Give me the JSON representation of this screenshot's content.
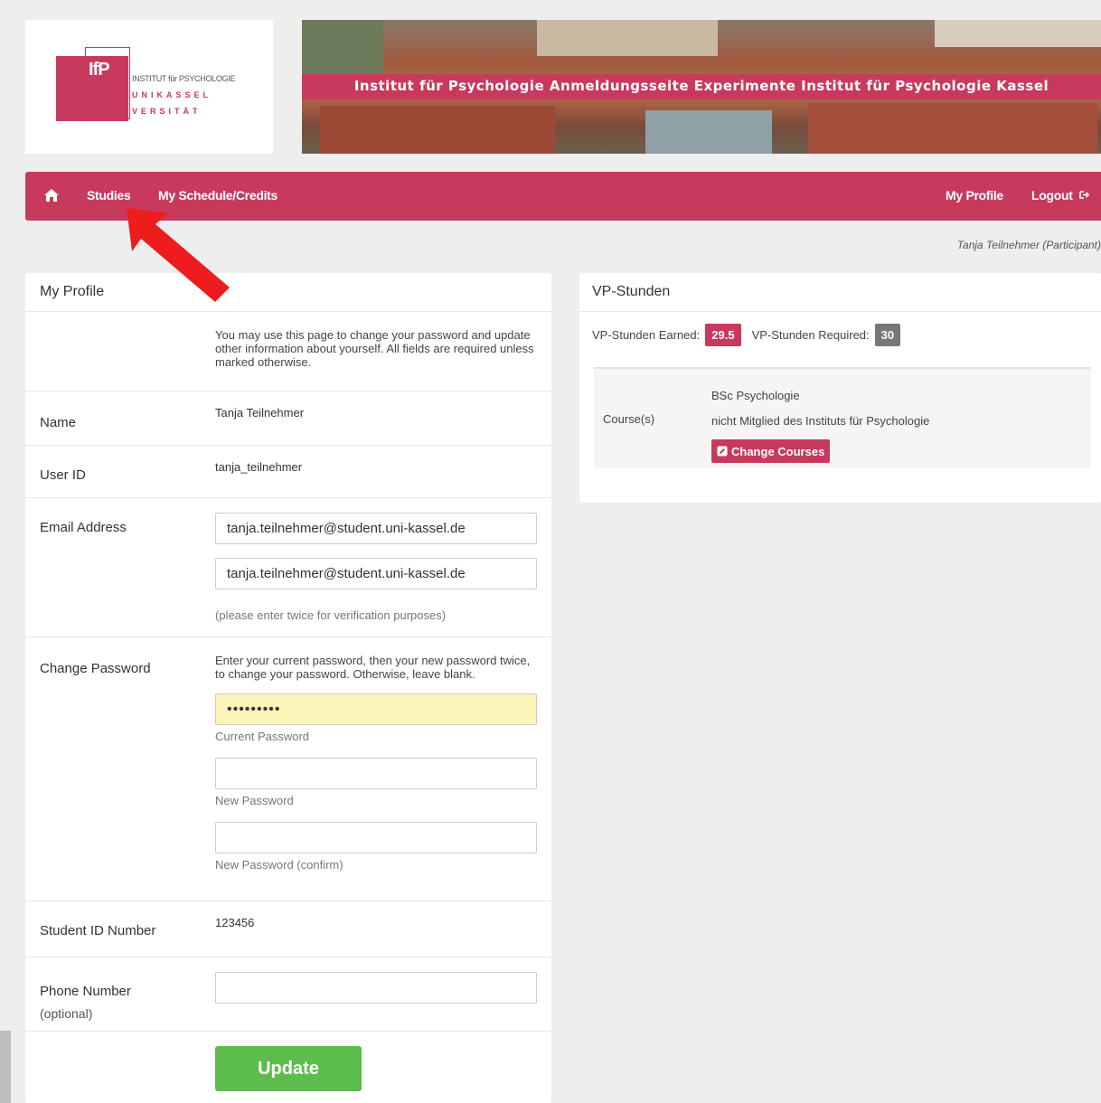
{
  "branding": {
    "logo_ifp": "IfP",
    "logo_line1": "INSTITUT für PSYCHOLOGIE",
    "logo_line2": "UNIKASSEL",
    "logo_line3": "VERSITÄT",
    "banner_title": "Institut für Psychologie Anmeldungsseite Experimente Institut für Psychologie Kassel",
    "brand_color": "#c8395e"
  },
  "nav": {
    "home_icon": "home-icon",
    "studies": "Studies",
    "schedule": "My Schedule/Credits",
    "my_profile": "My Profile",
    "logout": "Logout",
    "logout_icon": "logout-icon"
  },
  "user_line": "Tanja Teilnehmer (Participant)",
  "profile": {
    "title": "My Profile",
    "intro": "You may use this page to change your password and update other information about yourself. All fields are required unless marked otherwise.",
    "name_label": "Name",
    "name_value": "Tanja Teilnehmer",
    "userid_label": "User ID",
    "userid_value": "tanja_teilnehmer",
    "email_label": "Email Address",
    "email_value": "tanja.teilnehmer@student.uni-kassel.de",
    "email_confirm_value": "tanja.teilnehmer@student.uni-kassel.de",
    "email_hint": "(please enter twice for verification purposes)",
    "password_label": "Change Password",
    "password_help": "Enter your current password, then your new password twice, to change your password. Otherwise, leave blank.",
    "current_password_value": "•••••••••",
    "current_password_hint": "Current Password",
    "new_password_hint": "New Password",
    "new_password_confirm_hint": "New Password (confirm)",
    "student_id_label": "Student ID Number",
    "student_id_value": "123456",
    "phone_label": "Phone Number",
    "phone_optional": "(optional)",
    "phone_value": "",
    "update_button": "Update"
  },
  "vp": {
    "title": "VP-Stunden",
    "earned_label": "VP-Stunden Earned:",
    "earned_value": "29.5",
    "required_label": "VP-Stunden Required:",
    "required_value": "30",
    "courses_label": "Course(s)",
    "course_1": "BSc Psychologie",
    "course_2": "nicht Mitglied des Instituts für Psychologie",
    "change_courses_button": "Change Courses",
    "earned_color": "#c8395e",
    "required_color": "#777777"
  }
}
